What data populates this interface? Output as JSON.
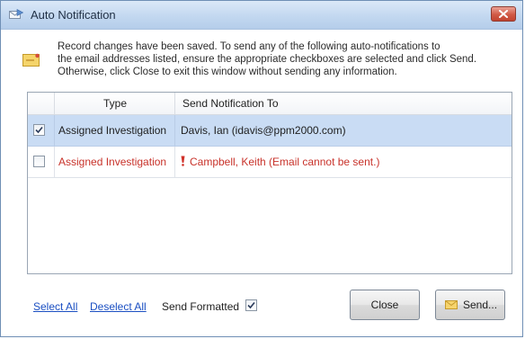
{
  "window": {
    "title": "Auto Notification"
  },
  "message": {
    "lines": [
      "Record changes have been saved. To send any of the following auto-notifications to",
      "the email addresses listed, ensure the appropriate checkboxes are selected and click Send.",
      "Otherwise, click Close to exit this window without sending any information."
    ]
  },
  "grid": {
    "columns": [
      "Type",
      "Send Notification To"
    ],
    "rows": [
      {
        "checked": true,
        "type": "Assigned Investigation",
        "recipient": "Davis,  Ian (idavis@ppm2000.com)",
        "error": false
      },
      {
        "checked": false,
        "type": "Assigned Investigation",
        "recipient": "Campbell, Keith (Email cannot be sent.)",
        "error": true
      }
    ]
  },
  "footer": {
    "select_all": "Select All",
    "deselect_all": "Deselect All",
    "send_formatted_label": "Send Formatted",
    "send_formatted_checked": true,
    "close_label": "Close",
    "send_label": "Send..."
  },
  "colors": {
    "error_text": "#c8322a",
    "selected_row": "#c9dcf4",
    "link": "#1b4fc2",
    "title_close": "#c24330"
  }
}
